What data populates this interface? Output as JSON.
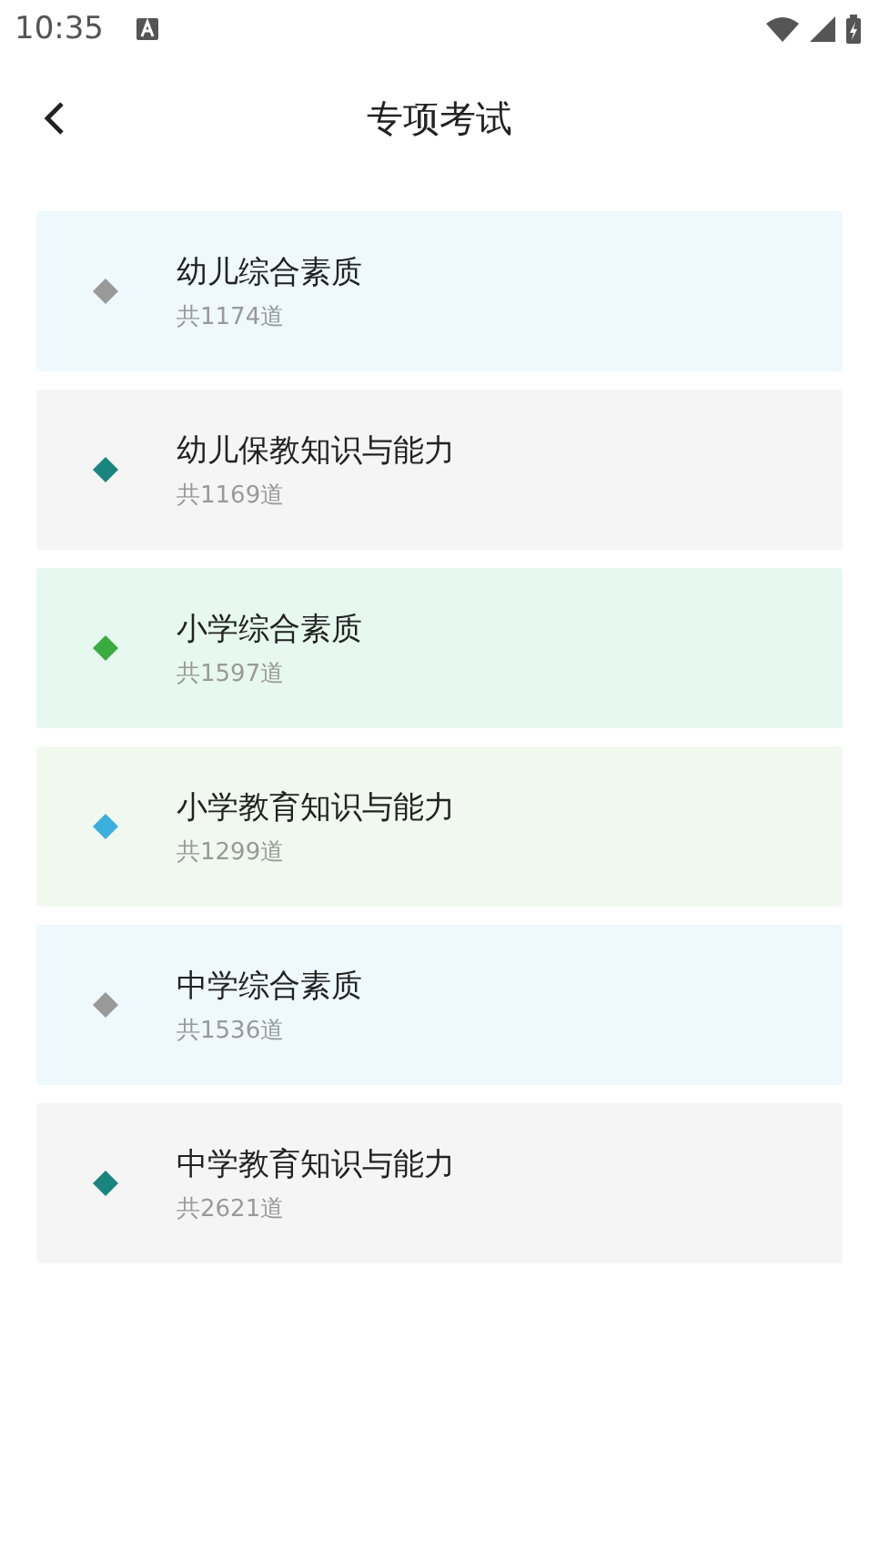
{
  "status_bar": {
    "time": "10:35"
  },
  "header": {
    "title": "专项考试"
  },
  "items": [
    {
      "title": "幼儿综合素质",
      "count": "共1174道",
      "color": "#999999",
      "kind": "sky"
    },
    {
      "title": "幼儿保教知识与能力",
      "count": "共1169道",
      "color": "#1a857f",
      "kind": "plain"
    },
    {
      "title": "小学综合素质",
      "count": "共1597道",
      "color": "#3aac3f",
      "kind": "mint"
    },
    {
      "title": "小学教育知识与能力",
      "count": "共1299道",
      "color": "#3bb0de",
      "kind": "sage"
    },
    {
      "title": "中学综合素质",
      "count": "共1536道",
      "color": "#999999",
      "kind": "sky"
    },
    {
      "title": "中学教育知识与能力",
      "count": "共2621道",
      "color": "#1a857f",
      "kind": "plain"
    }
  ]
}
